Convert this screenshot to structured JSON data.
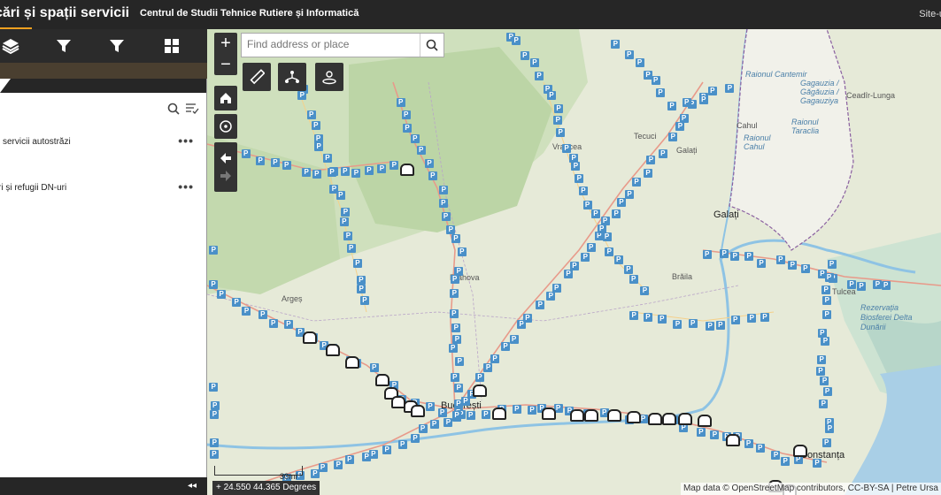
{
  "header": {
    "app_title": "cări și spații servicii",
    "subtitle": "Centrul de Studii Tehnice Rutiere și Informatică",
    "site_link": "Site-u"
  },
  "toolbar": {
    "buttons": [
      {
        "icon": "layers-icon",
        "name": "layers"
      },
      {
        "icon": "filter-icon",
        "name": "filter-1"
      },
      {
        "icon": "filter-icon",
        "name": "filter-2"
      },
      {
        "icon": "grid-icon",
        "name": "apps"
      }
    ]
  },
  "panel": {
    "layers": [
      {
        "label": "i servicii autostrăzi",
        "more": "•••"
      },
      {
        "label": "ri și refugii DN-uri",
        "more": "•••"
      }
    ],
    "collapse_label": "◂◂"
  },
  "map": {
    "search_placeholder": "Find address or place",
    "zoom_in": "+",
    "zoom_out": "−",
    "coords": "24.550 44.365 Degrees",
    "scale_label": "30mi",
    "attribution": "Map data © OpenStreetMap contributors, CC-BY-SA | Petre Ursa",
    "places": [
      {
        "text": "Raionul Cantemir",
        "style": "blue"
      },
      {
        "text": "Gagauzia / Găgăuzia / Gagauziya",
        "style": "blue"
      },
      {
        "text": "Ceadîr-Lunga",
        "style": "plain"
      },
      {
        "text": "Cahul",
        "style": "plain"
      },
      {
        "text": "Raionul Cahul",
        "style": "blue"
      },
      {
        "text": "Raionul Taraclia",
        "style": "blue"
      },
      {
        "text": "Vrancea",
        "style": "plain"
      },
      {
        "text": "Tecuci",
        "style": "plain"
      },
      {
        "text": "Galați",
        "style": "plain"
      },
      {
        "text": "Galați",
        "style": "city"
      },
      {
        "text": "Brăila",
        "style": "plain"
      },
      {
        "text": "Tulcea",
        "style": "plain"
      },
      {
        "text": "Rezervația Biosferei Delta Dunării",
        "style": "blue"
      },
      {
        "text": "Argeș",
        "style": "plain"
      },
      {
        "text": "Prahova",
        "style": "plain"
      },
      {
        "text": "București",
        "style": "city"
      },
      {
        "text": "Constanța",
        "style": "city"
      }
    ]
  },
  "colors": {
    "header_bg": "#262626",
    "accent": "#f0a020",
    "parking_marker": "#4a90c8",
    "rest_area_marker": "#222222",
    "land": "#e6ead8",
    "forest": "#c6dab4",
    "water": "#a9cfe6",
    "border": "#8a5fa0"
  }
}
